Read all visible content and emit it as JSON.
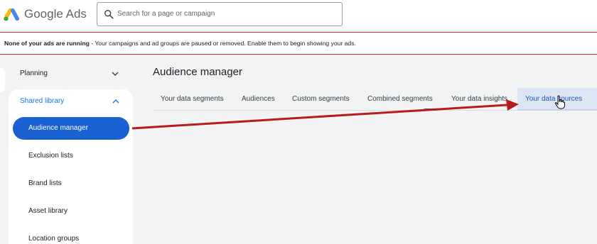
{
  "app": {
    "brand": "Google Ads"
  },
  "search": {
    "placeholder": "Search for a page or campaign"
  },
  "notice": {
    "bold": "None of your ads are running",
    "text": " - Your campaigns and ad groups are paused or removed. Enable them to begin showing your ads."
  },
  "sidebar": {
    "planning": "Planning",
    "shared_library": "Shared library",
    "items": [
      "Audience manager",
      "Exclusion lists",
      "Brand lists",
      "Asset library",
      "Location groups"
    ]
  },
  "main": {
    "title": "Audience manager",
    "tabs": [
      "Your data segments",
      "Audiences",
      "Custom segments",
      "Combined segments",
      "Your data insights",
      "Your data sources"
    ]
  },
  "colors": {
    "accent": "#1a73e8",
    "active_nav": "#1a60d0",
    "annotation_arrow": "#b71c1c",
    "notice_border": "#d93025"
  }
}
